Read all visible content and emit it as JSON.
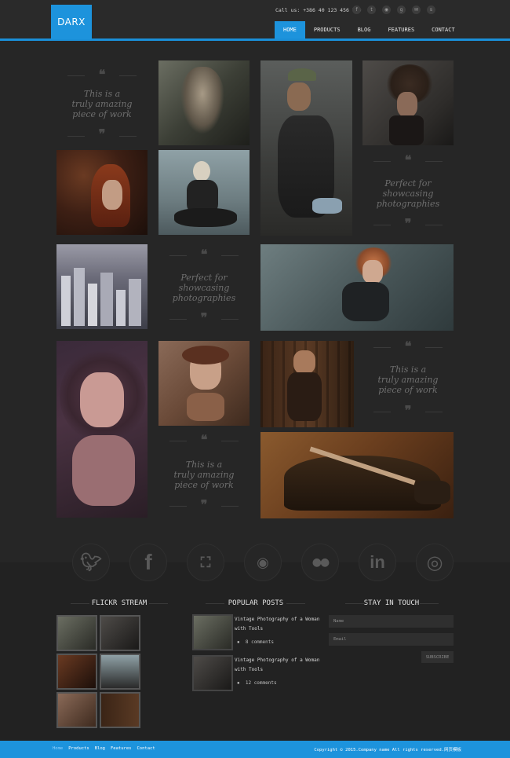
{
  "header": {
    "logo": "DARX",
    "call_us": "Call us: +386 40 123 456 789",
    "nav": [
      {
        "label": "HOME",
        "active": true
      },
      {
        "label": "PRODUCTS",
        "active": false
      },
      {
        "label": "BLOG",
        "active": false
      },
      {
        "label": "FEATURES",
        "active": false
      },
      {
        "label": "CONTACT",
        "active": false
      }
    ],
    "social_icons": [
      "facebook-icon",
      "twitter-icon",
      "rss-icon",
      "google-icon",
      "email-icon",
      "skype-icon"
    ]
  },
  "gallery": {
    "quotes": [
      "This is a\ntruly amazing\npiece of work",
      "Perfect for\nshowcasing\nphotographies",
      "Perfect for\nshowcasing\nphotographies",
      "This is a\ntruly amazing\npiece of work",
      "This is a\ntruly amazing\npiece of work"
    ]
  },
  "social_band": [
    "twitter-icon",
    "facebook-icon",
    "delicious-icon",
    "rss-icon",
    "flickr-icon",
    "linkedin-icon",
    "dribbble-icon"
  ],
  "flickr": {
    "title": "FLICKR STREAM"
  },
  "popular": {
    "title": "POPULAR POSTS",
    "posts": [
      {
        "title_line1": "Vintage Photography of a Woman",
        "title_line2": "with Tools",
        "comments": "8 comments"
      },
      {
        "title_line1": "Vintage Photography of a Woman",
        "title_line2": "with Tools",
        "comments": "12 comments"
      }
    ]
  },
  "stay": {
    "title": "STAY IN TOUCH",
    "name_placeholder": "Name",
    "email_placeholder": "Email",
    "subscribe": "SUBSCRIBE"
  },
  "footer": {
    "links": [
      "Home",
      "Products",
      "Blog",
      "Features",
      "Contact"
    ],
    "copyright": "Copyright © 2015.Company name All rights reserved.网页模板"
  },
  "colors": {
    "accent": "#1d93dc",
    "background": "#262626"
  }
}
